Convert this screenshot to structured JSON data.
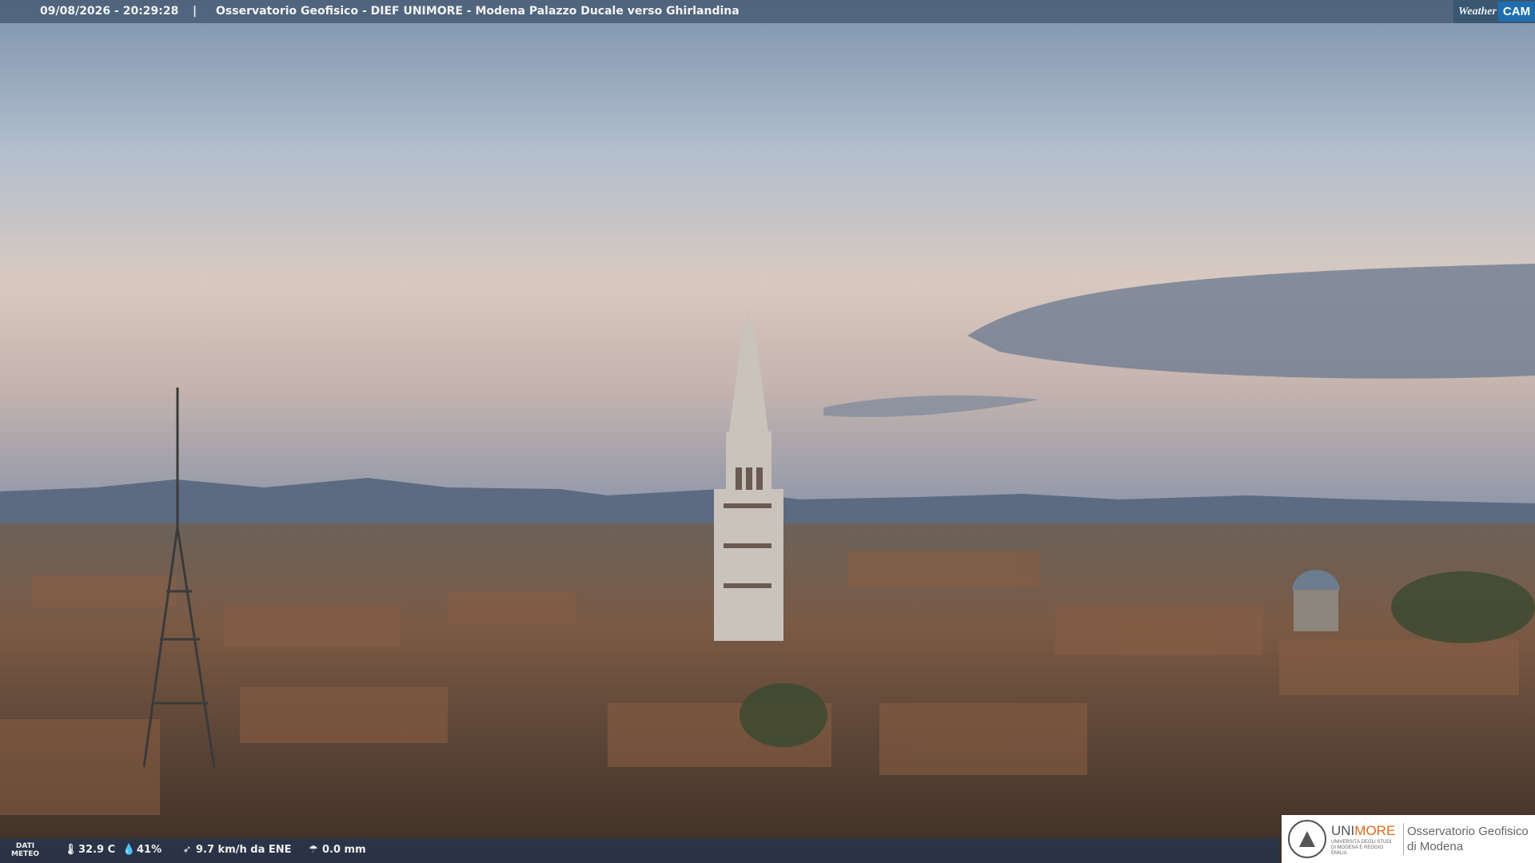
{
  "header": {
    "datetime": "09/08/2026 - 20:29:28",
    "separator": "|",
    "title": "Osservatorio Geofisico - DIEF UNIMORE - Modena Palazzo Ducale verso Ghirlandina",
    "logo_text": "Weather",
    "logo_cam": "CAM"
  },
  "weather": {
    "label_line1": "DATI",
    "label_line2": "METEO",
    "temperature": "32.9 C",
    "humidity": "41%",
    "wind": "9.7 km/h da ENE",
    "rain": "0.0 mm",
    "icons": [
      "thermometer-icon",
      "humidity-drop-icon",
      "wind-icon",
      "rain-gauge-icon"
    ]
  },
  "branding": {
    "university_prefix": "UNI",
    "university_suffix": "MORE",
    "university_sub": "UNIVERSITÀ DEGLI STUDI DI MODENA E REGGIO EMILIA",
    "observatory_line1": "Osservatorio Geofisico",
    "observatory_line2": "di Modena"
  },
  "colors": {
    "accent": "#e06a1a",
    "bar": "#465a73",
    "cam_blue": "#1f6fb0"
  }
}
